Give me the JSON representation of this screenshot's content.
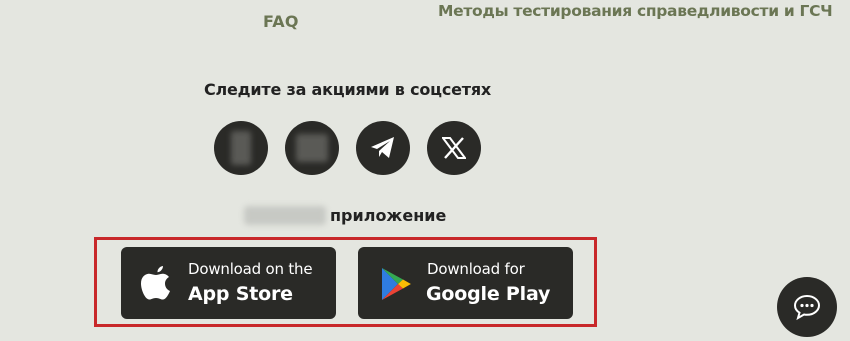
{
  "top_links": {
    "faq": "FAQ",
    "fairness": "Методы тестирования справедливости и ГСЧ"
  },
  "social": {
    "title": "Следите за акциями в соцсетях",
    "items": [
      {
        "icon": "blurred-social-icon"
      },
      {
        "icon": "blurred-social-icon"
      },
      {
        "icon": "telegram-icon"
      },
      {
        "icon": "x-icon"
      }
    ]
  },
  "app": {
    "title_suffix": "приложение",
    "app_store": {
      "sub": "Download on the",
      "main": "App Store"
    },
    "google_play": {
      "sub": "Download for",
      "main": "Google Play"
    }
  },
  "chat": {
    "icon": "chat-bubble-icon"
  },
  "colors": {
    "background": "#e4e6e0",
    "link": "#6b7654",
    "button": "#2a2a27",
    "highlight": "#c8282a"
  }
}
